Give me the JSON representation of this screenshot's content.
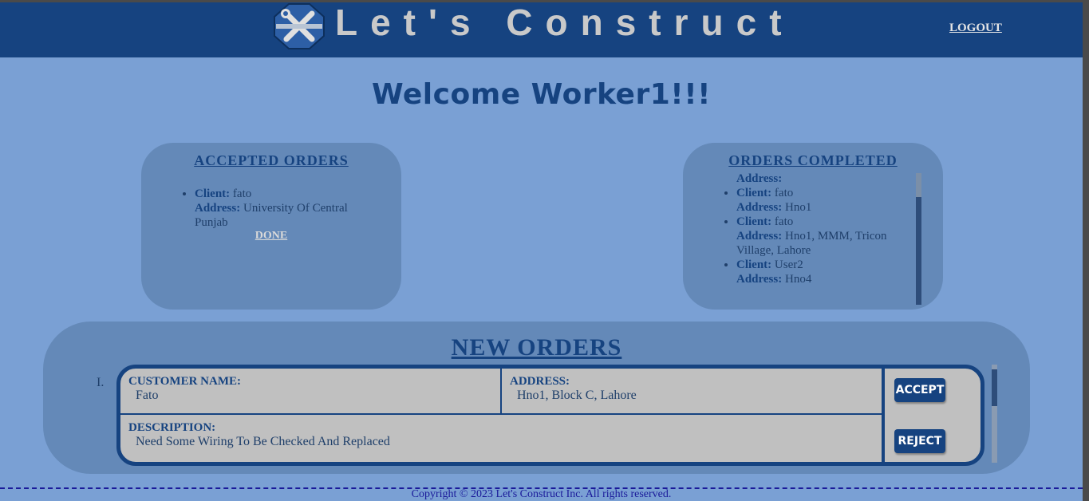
{
  "header": {
    "brand": "Let's Construct",
    "logout_label": "LOGOUT",
    "logo_icon": "wrench-screwdriver-icon"
  },
  "welcome": "Welcome Worker1!!!",
  "accepted_orders": {
    "title": "ACCEPTED ORDERS",
    "items": [
      {
        "client_label": "Client:",
        "client": "fato",
        "address_label": "Address:",
        "address": "University Of Central Punjab"
      }
    ],
    "done_label": "DONE"
  },
  "orders_completed": {
    "title": "ORDERS COMPLETED",
    "partial_label": "Address:",
    "items": [
      {
        "client_label": "Client:",
        "client": "fato",
        "address_label": "Address:",
        "address": "Hno1"
      },
      {
        "client_label": "Client:",
        "client": "fato",
        "address_label": "Address:",
        "address": "Hno1, MMM, Tricon Village, Lahore"
      },
      {
        "client_label": "Client:",
        "client": "User2",
        "address_label": "Address:",
        "address": "Hno4"
      }
    ]
  },
  "new_orders": {
    "title": "NEW ORDERS",
    "orders": [
      {
        "index": "I.",
        "customer_label": "CUSTOMER NAME:",
        "customer": "Fato",
        "address_label": "ADDRESS:",
        "address": "Hno1, Block C, Lahore",
        "description_label": "DESCRIPTION:",
        "description": "Need Some Wiring To Be Checked And Replaced",
        "accept_label": "ACCEPT",
        "reject_label": "REJECT"
      }
    ]
  },
  "footer": "Copyright © 2023 Let's Construct Inc. All rights reserved.",
  "colors": {
    "header_bg": "#164380",
    "page_bg": "#7aa0d4",
    "panel_bg": "#6489b8",
    "card_bg": "#c0c0c0"
  }
}
